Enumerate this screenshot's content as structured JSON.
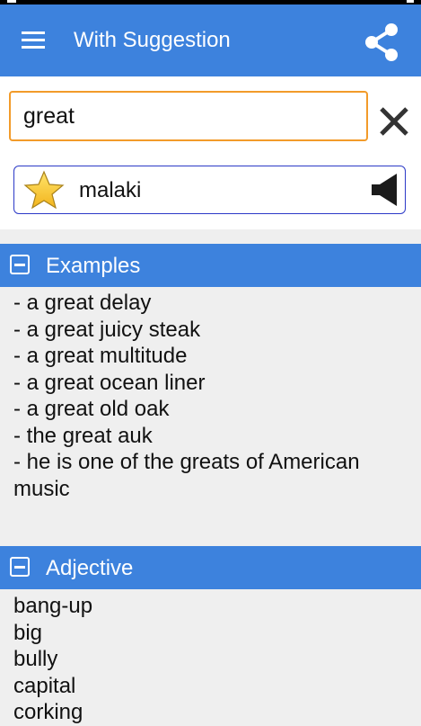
{
  "app_bar": {
    "title": "With Suggestion",
    "menu_icon": "hamburger-menu-icon",
    "share_icon": "share-icon",
    "color": "#3d82dd"
  },
  "search": {
    "value": "great",
    "placeholder": "",
    "clear_icon": "close-icon",
    "border_color": "#f29b2a"
  },
  "suggestion": {
    "word": "malaki",
    "favorite_icon": "star-icon",
    "audio_icon": "speaker-icon"
  },
  "sections": {
    "examples": {
      "title": "Examples",
      "items": [
        "- a great delay",
        "- a great juicy steak",
        "- a great multitude",
        "- a great ocean liner",
        "- a great old oak",
        "- the great auk",
        "- he is one of the greats of American music"
      ]
    },
    "adjective": {
      "title": "Adjective",
      "items": [
        "bang-up",
        "big",
        "bully",
        "capital",
        "corking"
      ]
    }
  }
}
